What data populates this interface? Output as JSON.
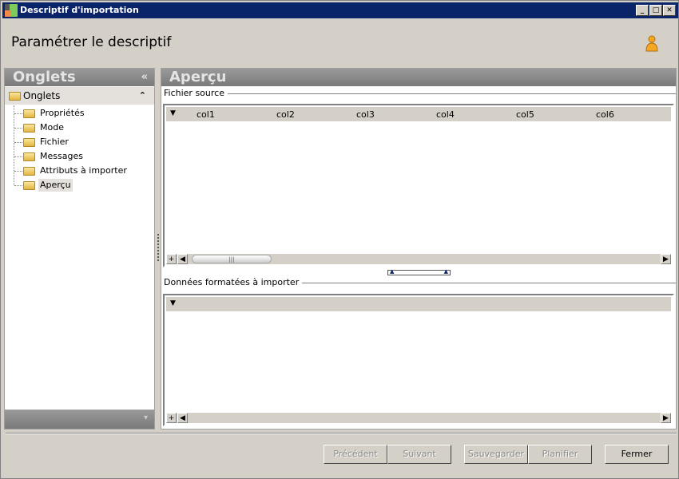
{
  "window": {
    "title": "Descriptif d'importation",
    "minimize": "_",
    "maximize": "□",
    "close": "✕"
  },
  "header": {
    "title": "Paramétrer le descriptif",
    "user_icon": "user-icon"
  },
  "left_panel": {
    "title": "Onglets",
    "collapse": "«",
    "root": "Onglets",
    "root_toggle": "⌃",
    "items": [
      {
        "label": "Propriétés"
      },
      {
        "label": "Mode"
      },
      {
        "label": "Fichier"
      },
      {
        "label": "Messages"
      },
      {
        "label": "Attributs à importer"
      },
      {
        "label": "Aperçu",
        "selected": true
      }
    ],
    "footer_arrow": "▾"
  },
  "right_panel": {
    "title": "Aperçu",
    "source": {
      "legend": "Fichier source",
      "columns": [
        "col1",
        "col2",
        "col3",
        "col4",
        "col5",
        "col6"
      ]
    },
    "formatted": {
      "legend": "Données formatées à importer",
      "columns": []
    }
  },
  "buttons": {
    "previous": "Précédent",
    "next": "Suivant",
    "save": "Sauvegarder",
    "schedule": "Planifier",
    "close": "Fermer"
  }
}
